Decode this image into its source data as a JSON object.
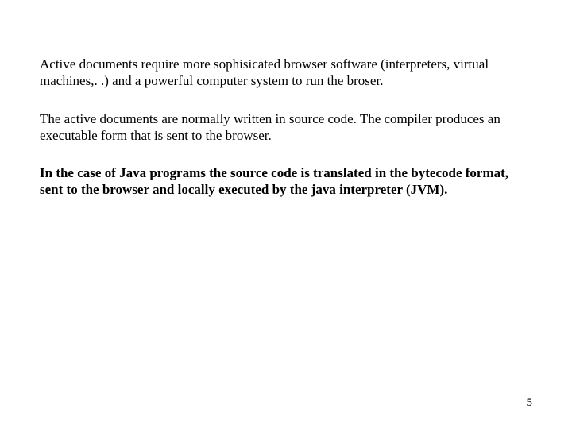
{
  "paragraphs": {
    "p1": "Active documents require more sophisicated browser software (interpreters, virtual machines,. .) and a powerful computer system to run the broser.",
    "p2": "The active documents are normally written in source code. The compiler produces an executable form that is sent to the browser.",
    "p3": "In the case of Java programs the source code is translated in the bytecode format, sent to the browser and locally executed by the java interpreter (JVM)."
  },
  "page_number": "5"
}
